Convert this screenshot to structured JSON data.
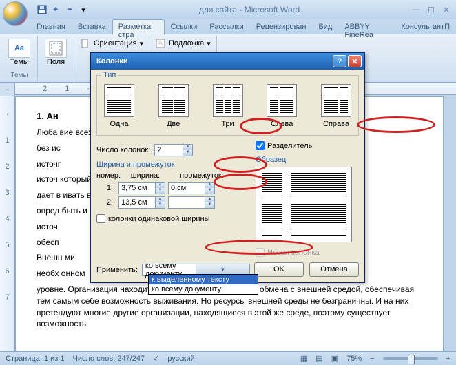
{
  "window_title": "для сайта - Microsoft Word",
  "tabs": [
    "Главная",
    "Вставка",
    "Разметка стра",
    "Ссылки",
    "Рассылки",
    "Рецензирован",
    "Вид",
    "ABBYY FineRea",
    "КонсультантП"
  ],
  "ribbon": {
    "themes_label": "Темы",
    "themes_btn": "Темы",
    "fields_btn": "Поля",
    "orientation": "Ориентация",
    "substrate": "Подложка"
  },
  "dialog": {
    "title": "Колонки",
    "type_legend": "Тип",
    "types": {
      "one": "Одна",
      "two": "Две",
      "three": "Три",
      "left": "Слева",
      "right": "Справа"
    },
    "num_cols_label": "Число колонок:",
    "num_cols_value": "2",
    "separator_label": "Разделитель",
    "width_gap_link": "Ширина и промежуток",
    "sample_label": "Образец",
    "hdr_num": "номер:",
    "hdr_width": "ширина:",
    "hdr_gap": "промежуток:",
    "rows": [
      {
        "n": "1:",
        "w": "3,75 см",
        "g": "0 см"
      },
      {
        "n": "2:",
        "w": "13,5 см",
        "g": ""
      }
    ],
    "equal_width": "колонки одинаковой ширины",
    "apply_label": "Применить:",
    "apply_options": [
      "ко всему документу",
      "к выделенному тексту",
      "ко всему документу"
    ],
    "new_col": "Новая колонка",
    "ok": "OK",
    "cancel": "Отмена"
  },
  "doc": {
    "h": "1. Ан",
    "p1": "Люба                                                                                                                вие всех",
    "p2": "без ис",
    "p3": "источг",
    "p4": "источ                                                                                                               который",
    "p5": "дает в                                                                                                               ивать в",
    "p6": "опред                                                                                                               быть и",
    "p7": "источ",
    "p8": "обесп",
    "p9": "Внешн                                                                                                              ми,",
    "p10": "необх                                                                                                              онном",
    "p11": "уровне. Организация находится в состоянии постоянного обмена с внешней средой, обеспечивая тем самым себе возможность выживания. Но ресурсы внешней среды не безграничны. И на них претендуют многие другие организации, находящиеся в этой же среде, поэтому существует возможность"
  },
  "status": {
    "page": "Страница: 1 из 1",
    "words": "Число слов: 247/247",
    "lang": "русский",
    "zoom": "75%"
  }
}
